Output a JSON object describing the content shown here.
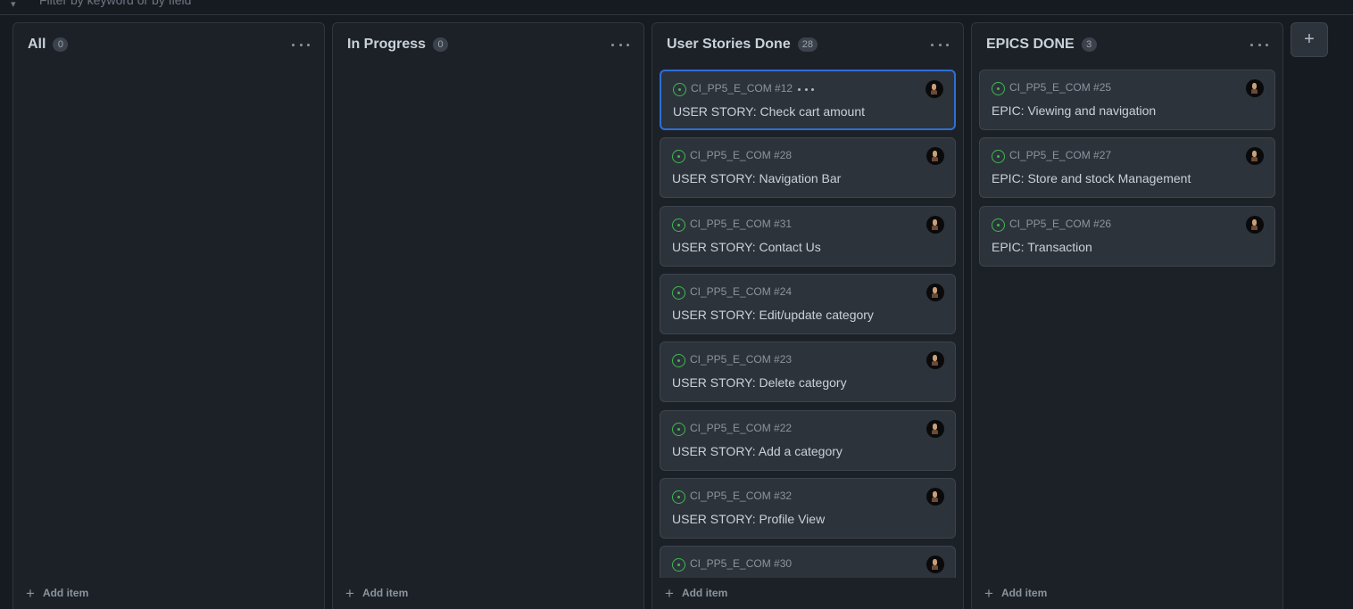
{
  "filter": {
    "icon": "filter-icon",
    "placeholder": "Filter by keyword or by field"
  },
  "columns": [
    {
      "title": "All",
      "count": "0",
      "add_label": "Add item",
      "cards": []
    },
    {
      "title": "In Progress",
      "count": "0",
      "add_label": "Add item",
      "cards": []
    },
    {
      "title": "User Stories Done",
      "count": "28",
      "add_label": "Add item",
      "cards": [
        {
          "ref": "CI_PP5_E_COM #12",
          "title": "USER STORY: Check cart amount",
          "selected": true
        },
        {
          "ref": "CI_PP5_E_COM #28",
          "title": "USER STORY: Navigation Bar"
        },
        {
          "ref": "CI_PP5_E_COM #31",
          "title": "USER STORY: Contact Us"
        },
        {
          "ref": "CI_PP5_E_COM #24",
          "title": "USER STORY: Edit/update category"
        },
        {
          "ref": "CI_PP5_E_COM #23",
          "title": "USER STORY: Delete category"
        },
        {
          "ref": "CI_PP5_E_COM #22",
          "title": "USER STORY: Add a category"
        },
        {
          "ref": "CI_PP5_E_COM #32",
          "title": "USER STORY: Profile View"
        },
        {
          "ref": "CI_PP5_E_COM #30",
          "title": ""
        }
      ]
    },
    {
      "title": "EPICS DONE",
      "count": "3",
      "add_label": "Add item",
      "cards": [
        {
          "ref": "CI_PP5_E_COM #25",
          "title": "EPIC: Viewing and navigation"
        },
        {
          "ref": "CI_PP5_E_COM #27",
          "title": "EPIC: Store and stock Management"
        },
        {
          "ref": "CI_PP5_E_COM #26",
          "title": "EPIC: Transaction"
        }
      ]
    }
  ],
  "add_column": {
    "label": "+",
    "icon": "plus-icon"
  },
  "colors": {
    "background": "#161b22",
    "column": "#1c2128",
    "card": "#2d333b",
    "open_status": "#3fb950",
    "selected_border": "#2f6ed6"
  }
}
